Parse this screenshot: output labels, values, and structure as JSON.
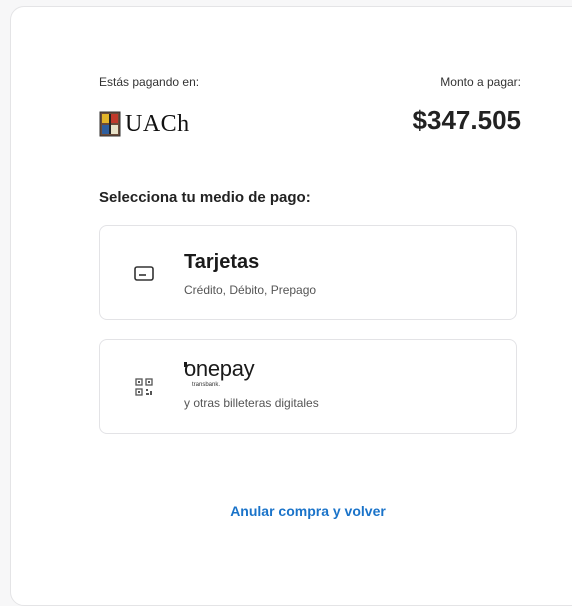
{
  "header": {
    "merchant_label": "Estás pagando en:",
    "amount_label": "Monto a pagar:",
    "merchant_name": "UACh",
    "amount": "$347.505"
  },
  "payment": {
    "section_title": "Selecciona tu medio de pago:",
    "methods": [
      {
        "title": "Tarjetas",
        "subtitle": "Crédito, Débito, Prepago",
        "icon": "credit-card-icon"
      },
      {
        "brand": "onepay",
        "brand_sub": "transbank.",
        "subtitle": "y otras billeteras digitales",
        "icon": "qr-code-icon"
      }
    ]
  },
  "footer": {
    "cancel_label": "Anular compra y volver"
  },
  "colors": {
    "link": "#1a73c9",
    "border": "#e3e3e6",
    "text": "#222222"
  }
}
